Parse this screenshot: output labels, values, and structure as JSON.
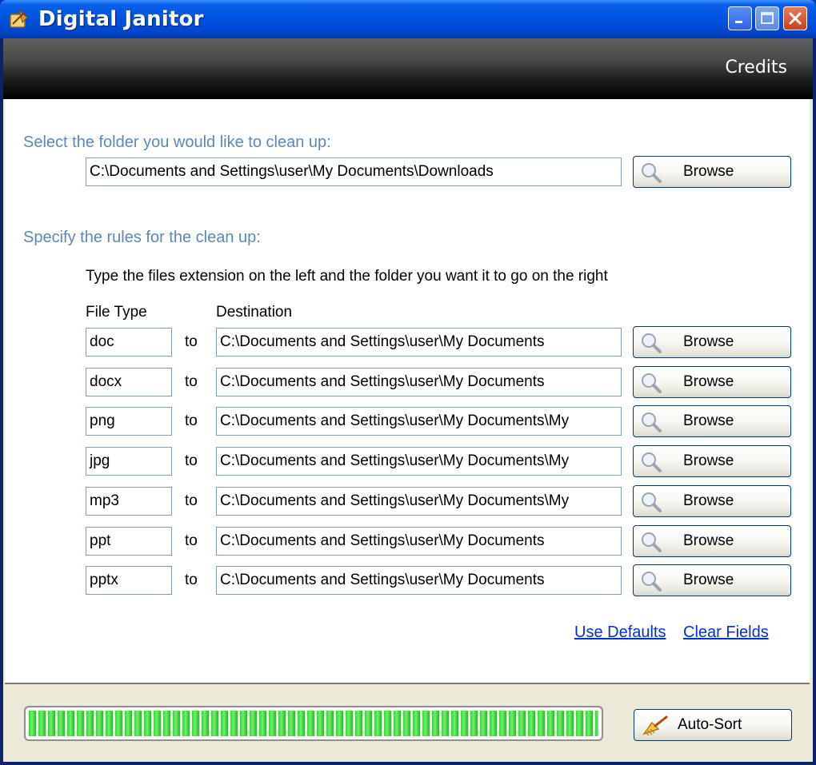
{
  "window": {
    "title": "Digital Janitor"
  },
  "header": {
    "credits_label": "Credits"
  },
  "folder_section": {
    "label": "Select the folder you would like to clean up:",
    "path_value": "C:\\Documents and Settings\\user\\My Documents\\Downloads",
    "browse_label": "Browse"
  },
  "rules_section": {
    "label": "Specify the rules for the clean up:",
    "instructions": "Type the files extension on the left and the folder you want it to go on the right",
    "col_file_type": "File Type",
    "col_destination": "Destination",
    "to_label": "to",
    "browse_label": "Browse",
    "rules": [
      {
        "ext": "doc",
        "dest": "C:\\Documents and Settings\\user\\My Documents"
      },
      {
        "ext": "docx",
        "dest": "C:\\Documents and Settings\\user\\My Documents"
      },
      {
        "ext": "png",
        "dest": "C:\\Documents and Settings\\user\\My Documents\\My"
      },
      {
        "ext": "jpg",
        "dest": "C:\\Documents and Settings\\user\\My Documents\\My"
      },
      {
        "ext": "mp3",
        "dest": "C:\\Documents and Settings\\user\\My Documents\\My"
      },
      {
        "ext": "ppt",
        "dest": "C:\\Documents and Settings\\user\\My Documents"
      },
      {
        "ext": "pptx",
        "dest": "C:\\Documents and Settings\\user\\My Documents"
      }
    ]
  },
  "links": {
    "use_defaults": "Use Defaults",
    "clear_fields": "Clear Fields"
  },
  "footer": {
    "progress_fraction": 1.0,
    "auto_sort_label": "Auto-Sort"
  },
  "colors": {
    "titlebar": "#0054e3",
    "section_label": "#5d88b8",
    "progress": "#37d637",
    "link": "#0033cc"
  },
  "icons": [
    "broom-app-icon",
    "minimize-icon",
    "maximize-icon",
    "close-icon",
    "magnifier-icon",
    "broom-icon"
  ]
}
